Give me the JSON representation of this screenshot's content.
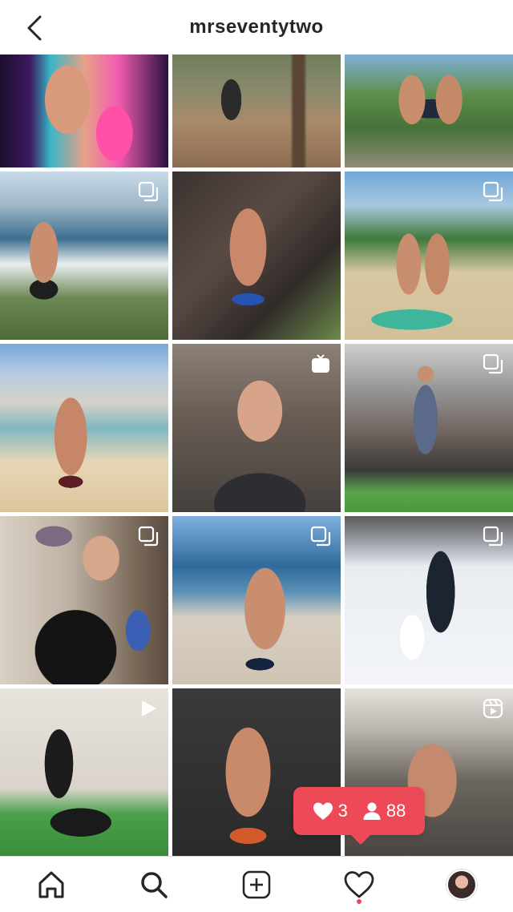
{
  "header": {
    "username": "mrseventytwo",
    "back_icon": "chevron-left-icon"
  },
  "grid": {
    "tiles": [
      {
        "name": "post-1",
        "badge": null
      },
      {
        "name": "post-2",
        "badge": null
      },
      {
        "name": "post-3",
        "badge": null
      },
      {
        "name": "post-4",
        "badge": "carousel"
      },
      {
        "name": "post-5",
        "badge": null
      },
      {
        "name": "post-6",
        "badge": "carousel"
      },
      {
        "name": "post-7",
        "badge": null
      },
      {
        "name": "post-8",
        "badge": "igtv"
      },
      {
        "name": "post-9",
        "badge": "carousel"
      },
      {
        "name": "post-10",
        "badge": "carousel"
      },
      {
        "name": "post-11",
        "badge": "carousel"
      },
      {
        "name": "post-12",
        "badge": "carousel"
      },
      {
        "name": "post-13",
        "badge": "video"
      },
      {
        "name": "post-14",
        "badge": null
      },
      {
        "name": "post-15",
        "badge": "reels"
      }
    ]
  },
  "notification": {
    "likes": "3",
    "followers": "88",
    "color": "#ed4956"
  },
  "bottom_nav": {
    "items": [
      "home-icon",
      "search-icon",
      "add-post-icon",
      "activity-icon",
      "profile-avatar"
    ]
  }
}
